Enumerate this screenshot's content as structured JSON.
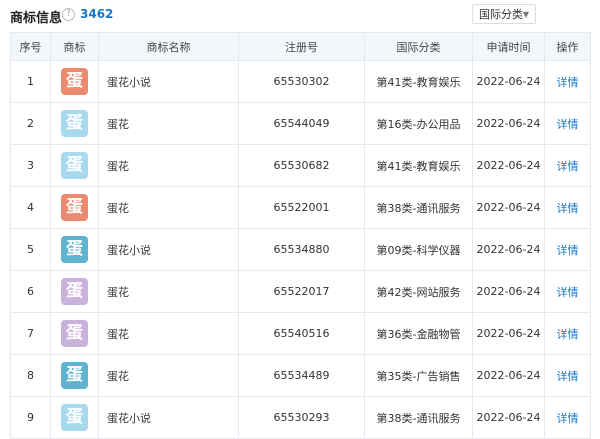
{
  "header": {
    "title": "商标信息",
    "help_icon": "?",
    "count": "3462",
    "filter_label": "国际分类"
  },
  "table": {
    "columns": [
      "序号",
      "商标",
      "商标名称",
      "注册号",
      "国际分类",
      "申请时间",
      "操作"
    ],
    "rows": [
      {
        "index": "1",
        "logo_char": "蛋",
        "logo_color": "#ea8b6f",
        "name": "蛋花小说",
        "reg_no": "65530302",
        "category": "第41类-教育娱乐",
        "date": "2022-06-24",
        "action": "详情"
      },
      {
        "index": "2",
        "logo_char": "蛋",
        "logo_color": "#a8d9ee",
        "name": "蛋花",
        "reg_no": "65544049",
        "category": "第16类-办公用品",
        "date": "2022-06-24",
        "action": "详情"
      },
      {
        "index": "3",
        "logo_char": "蛋",
        "logo_color": "#a8d9ee",
        "name": "蛋花",
        "reg_no": "65530682",
        "category": "第41类-教育娱乐",
        "date": "2022-06-24",
        "action": "详情"
      },
      {
        "index": "4",
        "logo_char": "蛋",
        "logo_color": "#ea8b6f",
        "name": "蛋花",
        "reg_no": "65522001",
        "category": "第38类-通讯服务",
        "date": "2022-06-24",
        "action": "详情"
      },
      {
        "index": "5",
        "logo_char": "蛋",
        "logo_color": "#5fb3cf",
        "name": "蛋花小说",
        "reg_no": "65534880",
        "category": "第09类-科学仪器",
        "date": "2022-06-24",
        "action": "详情"
      },
      {
        "index": "6",
        "logo_char": "蛋",
        "logo_color": "#c9b3dd",
        "name": "蛋花",
        "reg_no": "65522017",
        "category": "第42类-网站服务",
        "date": "2022-06-24",
        "action": "详情"
      },
      {
        "index": "7",
        "logo_char": "蛋",
        "logo_color": "#c9b3dd",
        "name": "蛋花",
        "reg_no": "65540516",
        "category": "第36类-金融物管",
        "date": "2022-06-24",
        "action": "详情"
      },
      {
        "index": "8",
        "logo_char": "蛋",
        "logo_color": "#5fb3cf",
        "name": "蛋花",
        "reg_no": "65534489",
        "category": "第35类-广告销售",
        "date": "2022-06-24",
        "action": "详情"
      },
      {
        "index": "9",
        "logo_char": "蛋",
        "logo_color": "#a8d9ee",
        "name": "蛋花小说",
        "reg_no": "65530293",
        "category": "第38类-通讯服务",
        "date": "2022-06-24",
        "action": "详情"
      }
    ]
  },
  "colors": {
    "accent": "#1677c9",
    "header_bg": "#f3f6fa",
    "border": "#e4e9f0"
  }
}
